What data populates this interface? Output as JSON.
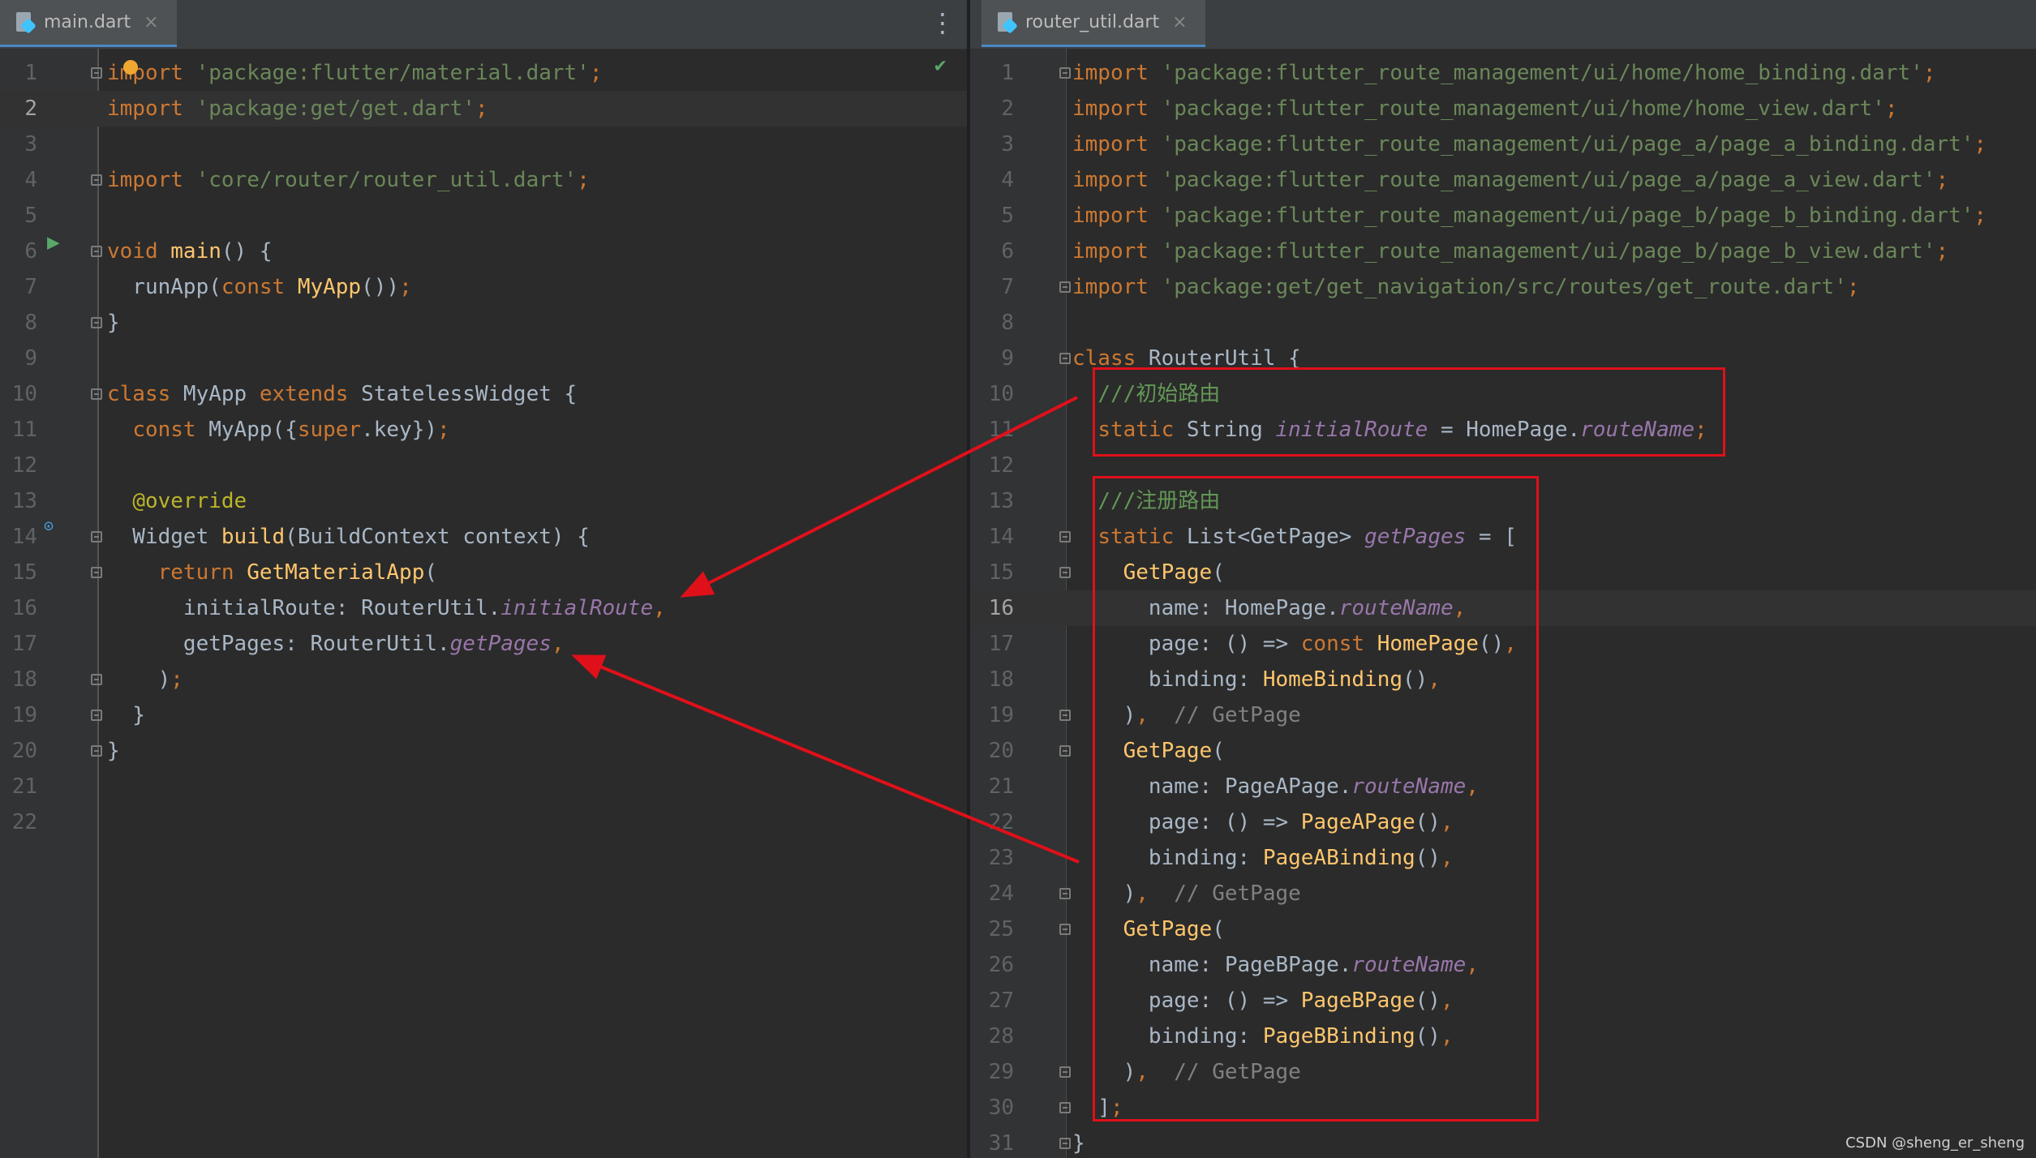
{
  "left_editor": {
    "tab": {
      "label": "main.dart",
      "close": "×"
    },
    "more_menu": "⋮",
    "lines": [
      [
        {
          "t": "import ",
          "c": "kw"
        },
        {
          "t": "'package:flutter/material.dart'",
          "c": "str"
        },
        {
          "t": ";",
          "c": "kw"
        }
      ],
      [
        {
          "t": "import ",
          "c": "kw"
        },
        {
          "t": "'package:get/get.dart'",
          "c": "str"
        },
        {
          "t": ";",
          "c": "kw"
        }
      ],
      [],
      [
        {
          "t": "import ",
          "c": "kw"
        },
        {
          "t": "'core/router/router_util.dart'",
          "c": "str"
        },
        {
          "t": ";",
          "c": "kw"
        }
      ],
      [],
      [
        {
          "t": "void ",
          "c": "kw"
        },
        {
          "t": "main",
          "c": "fn"
        },
        {
          "t": "() {"
        }
      ],
      [
        {
          "t": "  runApp("
        },
        {
          "t": "const ",
          "c": "kw"
        },
        {
          "t": "MyApp",
          "c": "fn"
        },
        {
          "t": "())"
        },
        {
          "t": ";",
          "c": "kw"
        }
      ],
      [
        {
          "t": "}"
        }
      ],
      [],
      [
        {
          "t": "class ",
          "c": "kw"
        },
        {
          "t": "MyApp "
        },
        {
          "t": "extends ",
          "c": "kw"
        },
        {
          "t": "StatelessWidget {"
        }
      ],
      [
        {
          "t": "  "
        },
        {
          "t": "const ",
          "c": "kw"
        },
        {
          "t": "MyApp({"
        },
        {
          "t": "super",
          "c": "kw"
        },
        {
          "t": ".key})"
        },
        {
          "t": ";",
          "c": "kw"
        }
      ],
      [],
      [
        {
          "t": "  "
        },
        {
          "t": "@override",
          "c": "ann"
        }
      ],
      [
        {
          "t": "  Widget "
        },
        {
          "t": "build",
          "c": "fn"
        },
        {
          "t": "(BuildContext context) {"
        }
      ],
      [
        {
          "t": "    "
        },
        {
          "t": "return ",
          "c": "kw"
        },
        {
          "t": "GetMaterialApp",
          "c": "fn"
        },
        {
          "t": "("
        }
      ],
      [
        {
          "t": "      initialRoute: RouterUtil."
        },
        {
          "t": "initialRoute",
          "c": "st"
        },
        {
          "t": ",",
          "c": "kw"
        }
      ],
      [
        {
          "t": "      getPages: RouterUtil."
        },
        {
          "t": "getPages",
          "c": "st"
        },
        {
          "t": ",",
          "c": "kw"
        }
      ],
      [
        {
          "t": "    )"
        },
        {
          "t": ";",
          "c": "kw"
        }
      ],
      [
        {
          "t": "  }"
        }
      ],
      [
        {
          "t": "}"
        }
      ],
      [],
      []
    ]
  },
  "right_editor": {
    "tab": {
      "label": "router_util.dart",
      "close": "×"
    },
    "lines": [
      [
        {
          "t": "import ",
          "c": "kw"
        },
        {
          "t": "'package:flutter_route_management/ui/home/home_binding.dart'",
          "c": "str"
        },
        {
          "t": ";",
          "c": "kw"
        }
      ],
      [
        {
          "t": "import ",
          "c": "kw"
        },
        {
          "t": "'package:flutter_route_management/ui/home/home_view.dart'",
          "c": "str"
        },
        {
          "t": ";",
          "c": "kw"
        }
      ],
      [
        {
          "t": "import ",
          "c": "kw"
        },
        {
          "t": "'package:flutter_route_management/ui/page_a/page_a_binding.dart'",
          "c": "str"
        },
        {
          "t": ";",
          "c": "kw"
        }
      ],
      [
        {
          "t": "import ",
          "c": "kw"
        },
        {
          "t": "'package:flutter_route_management/ui/page_a/page_a_view.dart'",
          "c": "str"
        },
        {
          "t": ";",
          "c": "kw"
        }
      ],
      [
        {
          "t": "import ",
          "c": "kw"
        },
        {
          "t": "'package:flutter_route_management/ui/page_b/page_b_binding.dart'",
          "c": "str"
        },
        {
          "t": ";",
          "c": "kw"
        }
      ],
      [
        {
          "t": "import ",
          "c": "kw"
        },
        {
          "t": "'package:flutter_route_management/ui/page_b/page_b_view.dart'",
          "c": "str"
        },
        {
          "t": ";",
          "c": "kw"
        }
      ],
      [
        {
          "t": "import ",
          "c": "kw"
        },
        {
          "t": "'package:get/get_navigation/src/routes/get_route.dart'",
          "c": "str"
        },
        {
          "t": ";",
          "c": "kw"
        }
      ],
      [],
      [
        {
          "t": "class ",
          "c": "kw"
        },
        {
          "t": "RouterUtil {"
        }
      ],
      [
        {
          "t": "  "
        },
        {
          "t": "///初始路由",
          "c": "doc-cm"
        }
      ],
      [
        {
          "t": "  "
        },
        {
          "t": "static ",
          "c": "kw"
        },
        {
          "t": "String "
        },
        {
          "t": "initialRoute",
          "c": "st"
        },
        {
          "t": " = HomePage."
        },
        {
          "t": "routeName",
          "c": "st"
        },
        {
          "t": ";",
          "c": "kw"
        }
      ],
      [],
      [
        {
          "t": "  "
        },
        {
          "t": "///注册路由",
          "c": "doc-cm"
        }
      ],
      [
        {
          "t": "  "
        },
        {
          "t": "static ",
          "c": "kw"
        },
        {
          "t": "List<GetPage> "
        },
        {
          "t": "getPages",
          "c": "st"
        },
        {
          "t": " = ["
        }
      ],
      [
        {
          "t": "    "
        },
        {
          "t": "GetPage",
          "c": "fn"
        },
        {
          "t": "("
        }
      ],
      [
        {
          "t": "      name: HomePage."
        },
        {
          "t": "routeName",
          "c": "st"
        },
        {
          "t": ",",
          "c": "kw"
        }
      ],
      [
        {
          "t": "      page: () => "
        },
        {
          "t": "const ",
          "c": "kw"
        },
        {
          "t": "HomePage",
          "c": "fn"
        },
        {
          "t": "()"
        },
        {
          "t": ",",
          "c": "kw"
        }
      ],
      [
        {
          "t": "      binding: "
        },
        {
          "t": "HomeBinding",
          "c": "fn"
        },
        {
          "t": "()"
        },
        {
          "t": ",",
          "c": "kw"
        }
      ],
      [
        {
          "t": "    )"
        },
        {
          "t": ",",
          "c": "kw"
        },
        {
          "t": "  "
        },
        {
          "t": "// GetPage",
          "c": "cm"
        }
      ],
      [
        {
          "t": "    "
        },
        {
          "t": "GetPage",
          "c": "fn"
        },
        {
          "t": "("
        }
      ],
      [
        {
          "t": "      name: PageAPage."
        },
        {
          "t": "routeName",
          "c": "st"
        },
        {
          "t": ",",
          "c": "kw"
        }
      ],
      [
        {
          "t": "      page: () => "
        },
        {
          "t": "PageAPage",
          "c": "fn"
        },
        {
          "t": "()"
        },
        {
          "t": ",",
          "c": "kw"
        }
      ],
      [
        {
          "t": "      binding: "
        },
        {
          "t": "PageABinding",
          "c": "fn"
        },
        {
          "t": "()"
        },
        {
          "t": ",",
          "c": "kw"
        }
      ],
      [
        {
          "t": "    )"
        },
        {
          "t": ",",
          "c": "kw"
        },
        {
          "t": "  "
        },
        {
          "t": "// GetPage",
          "c": "cm"
        }
      ],
      [
        {
          "t": "    "
        },
        {
          "t": "GetPage",
          "c": "fn"
        },
        {
          "t": "("
        }
      ],
      [
        {
          "t": "      name: PageBPage."
        },
        {
          "t": "routeName",
          "c": "st"
        },
        {
          "t": ",",
          "c": "kw"
        }
      ],
      [
        {
          "t": "      page: () => "
        },
        {
          "t": "PageBPage",
          "c": "fn"
        },
        {
          "t": "()"
        },
        {
          "t": ",",
          "c": "kw"
        }
      ],
      [
        {
          "t": "      binding: "
        },
        {
          "t": "PageBBinding",
          "c": "fn"
        },
        {
          "t": "()"
        },
        {
          "t": ",",
          "c": "kw"
        }
      ],
      [
        {
          "t": "    )"
        },
        {
          "t": ",",
          "c": "kw"
        },
        {
          "t": "  "
        },
        {
          "t": "// GetPage",
          "c": "cm"
        }
      ],
      [
        {
          "t": "  ]"
        },
        {
          "t": ";",
          "c": "kw"
        }
      ],
      [
        {
          "t": "}"
        }
      ]
    ]
  },
  "watermark": "CSDN @sheng_er_sheng",
  "annotation_color": "#e0101a",
  "syntax_colors": {
    "keyword": "#cc7832",
    "string": "#6a8759",
    "function": "#ffc66d",
    "static_field": "#9876aa",
    "comment": "#808080",
    "doc_comment": "#629755",
    "annotation": "#bbb529",
    "default": "#a9b7c6"
  }
}
